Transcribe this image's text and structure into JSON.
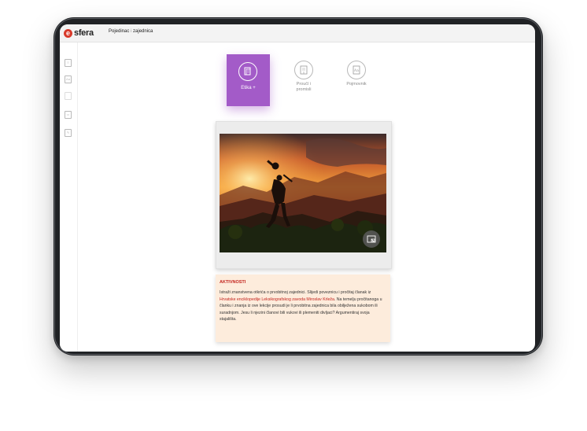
{
  "app": {
    "logo_letter": "e",
    "logo_text": "sfera",
    "breadcrumb_a": "Pojedinac",
    "breadcrumb_sep": "i",
    "breadcrumb_b": "zajednica"
  },
  "tiles": [
    {
      "label": "Etika +",
      "icon": "book-icon",
      "active": true
    },
    {
      "label_line1": "Proučí i",
      "label_line2": "promisli",
      "icon": "notebook-icon",
      "active": false
    },
    {
      "label": "Pojmovnik",
      "icon": "dictionary-icon",
      "active": false
    }
  ],
  "sidebar_icons": [
    "document-icon",
    "text-icon",
    "blank-icon",
    "image-icon",
    "edit-icon"
  ],
  "photo": {
    "alt_icon": "expand-icon"
  },
  "activity": {
    "title": "AKTIVNOSTI",
    "text_before_link": "Istraži znanstvena otkrića o prvobitnoj zajednici. Slijedi poveznicu i pročitaj članak iz",
    "link_text": "Hrvatske enciklopedije Leksikografskog zavoda Miroslav Krleža",
    "text_after_link": ". Na temelju pročitanoga u članku i znanja iz ove lekcije prosudi je li prvobitna zajednica bila obilježena sukobom ili suradnjom. Jesu li njezini članovi bili vukovi ili plemeniti divljaci? Argumentiraj svoja stajališta."
  },
  "colors": {
    "accent_purple": "#a35bc8",
    "brand_red": "#d83a2b",
    "activity_bg": "#fdecdc",
    "link_red": "#c3231d"
  }
}
